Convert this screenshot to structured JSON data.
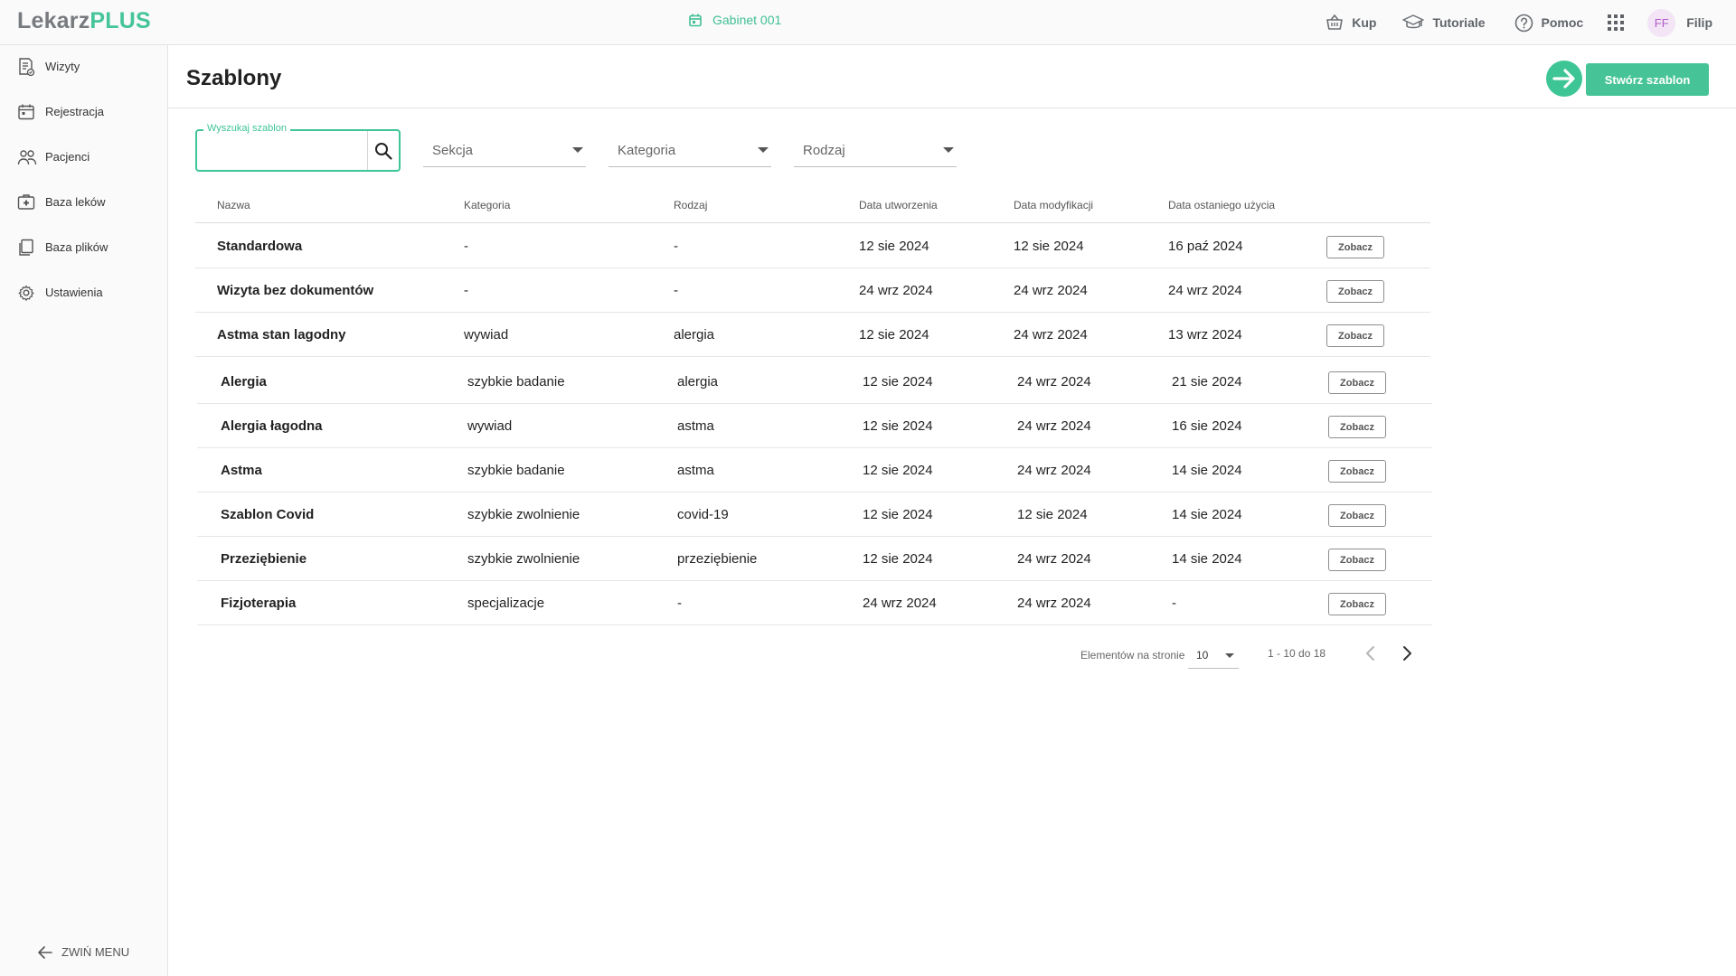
{
  "app": {
    "logo_part1": "Lekarz",
    "logo_part2": "PLUS"
  },
  "topbar": {
    "clinic": "Gabinet 001",
    "links": [
      {
        "label": "Kup",
        "icon": "basket-icon"
      },
      {
        "label": "Tutoriale",
        "icon": "graduation-cap-icon"
      },
      {
        "label": "Pomoc",
        "icon": "help-circle-icon"
      }
    ],
    "user": {
      "initials": "FF",
      "name": "Filip"
    }
  },
  "sidebar": {
    "items": [
      {
        "label": "Wizyty",
        "icon": "visits-icon"
      },
      {
        "label": "Rejestracja",
        "icon": "calendar-icon"
      },
      {
        "label": "Pacjenci",
        "icon": "patients-icon"
      },
      {
        "label": "Baza leków",
        "icon": "medical-kit-icon"
      },
      {
        "label": "Baza plików",
        "icon": "files-icon"
      },
      {
        "label": "Ustawienia",
        "icon": "gear-icon"
      }
    ],
    "collapse_label": "ZWIŃ MENU"
  },
  "page": {
    "title": "Szablony",
    "create_label": "Stwórz szablon"
  },
  "filters": {
    "search_label": "Wyszukaj szablon",
    "search_value": "",
    "section": "Sekcja",
    "category": "Kategoria",
    "type": "Rodzaj"
  },
  "table": {
    "headers": [
      "Nazwa",
      "Kategoria",
      "Rodzaj",
      "Data utworzenia",
      "Data modyfikacji",
      "Data ostaniego użycia"
    ],
    "view_label": "Zobacz",
    "rows": [
      {
        "name": "Standardowa",
        "category": "-",
        "type": "-",
        "created": "12 sie 2024",
        "modified": "12 sie 2024",
        "last_used": "16 paź 2024"
      },
      {
        "name": "Wizyta bez dokumentów",
        "category": "-",
        "type": "-",
        "created": "24 wrz 2024",
        "modified": "24 wrz 2024",
        "last_used": "24 wrz 2024"
      },
      {
        "name": "Astma stan lagodny",
        "category": "wywiad",
        "type": "alergia",
        "created": "12 sie 2024",
        "modified": "24 wrz 2024",
        "last_used": "13 wrz 2024"
      },
      {
        "name": "Alergia",
        "category": "szybkie badanie",
        "type": "alergia",
        "created": "12 sie 2024",
        "modified": "24 wrz 2024",
        "last_used": "21 sie 2024"
      },
      {
        "name": "Alergia łagodna",
        "category": "wywiad",
        "type": "astma",
        "created": "12 sie 2024",
        "modified": "24 wrz 2024",
        "last_used": "16 sie 2024"
      },
      {
        "name": "Astma",
        "category": "szybkie badanie",
        "type": "astma",
        "created": "12 sie 2024",
        "modified": "24 wrz 2024",
        "last_used": "14 sie 2024"
      },
      {
        "name": "Szablon Covid",
        "category": "szybkie zwolnienie",
        "type": "covid-19",
        "created": "12 sie 2024",
        "modified": "12 sie 2024",
        "last_used": "14 sie 2024"
      },
      {
        "name": "Przeziębienie",
        "category": "szybkie zwolnienie",
        "type": "przeziębienie",
        "created": "12 sie 2024",
        "modified": "24 wrz 2024",
        "last_used": "14 sie 2024"
      },
      {
        "name": "Fizjoterapia",
        "category": "specjalizacje",
        "type": "-",
        "created": "24 wrz 2024",
        "modified": "24 wrz 2024",
        "last_used": "-"
      }
    ]
  },
  "pagination": {
    "per_page_label": "Elementów na stronie",
    "per_page": "10",
    "range": "1 - 10 do 18"
  },
  "colors": {
    "accent": "#3ec595",
    "accent_button": "#47c497",
    "avatar_bg": "#f3e4f6",
    "avatar_text": "#b45cc8"
  }
}
